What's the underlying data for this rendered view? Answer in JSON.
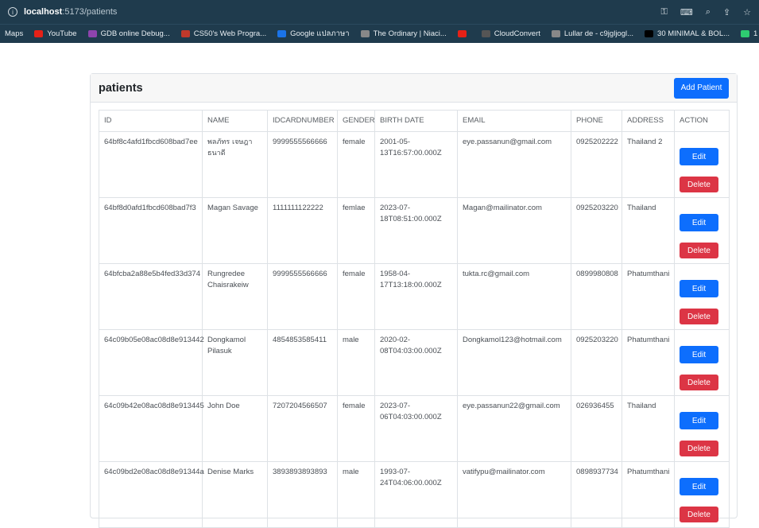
{
  "browser": {
    "url_host": "localhost",
    "url_path": ":5173/patients",
    "bookmarks": [
      {
        "label": "Maps",
        "color": ""
      },
      {
        "label": "YouTube",
        "color": "#e62117"
      },
      {
        "label": "GDB online Debug...",
        "color": "#8e44ad"
      },
      {
        "label": "CS50's Web Progra...",
        "color": "#c0392b"
      },
      {
        "label": "Google แปลภาษา",
        "color": "#1a73e8"
      },
      {
        "label": "The Ordinary | Niaci...",
        "color": "#888888"
      },
      {
        "label": "",
        "color": "#e62117"
      },
      {
        "label": "CloudConvert",
        "color": "#555555"
      },
      {
        "label": "Lullar de - c9jgljogl...",
        "color": "#888888"
      },
      {
        "label": "30 MINIMAL & BOL...",
        "color": "#000000"
      },
      {
        "label": "1",
        "color": "#2ecc71"
      }
    ]
  },
  "page": {
    "title": "patients",
    "add_label": "Add Patient",
    "edit_label": "Edit",
    "delete_label": "Delete"
  },
  "table": {
    "columns": [
      "ID",
      "NAME",
      "IDCARDNUMBER",
      "GENDER",
      "BIRTH DATE",
      "EMAIL",
      "PHONE",
      "ADDRESS",
      "ACTION"
    ],
    "rows": [
      {
        "id": "64bf8c4afd1fbcd608bad7ee",
        "name": "พลภัทร เจษฎา ธนาดี",
        "idcard": "9999555566666",
        "gender": "female",
        "birth": "2001-05-13T16:57:00.000Z",
        "email": "eye.passanun@gmail.com",
        "phone": "0925202222",
        "address": "Thailand 2"
      },
      {
        "id": "64bf8d0afd1fbcd608bad7f3",
        "name": "Magan Savage",
        "idcard": "1111111122222",
        "gender": "femlae",
        "birth": "2023-07-18T08:51:00.000Z",
        "email": "Magan@mailinator.com",
        "phone": "0925203220",
        "address": "Thailand"
      },
      {
        "id": "64bfcba2a88e5b4fed33d374",
        "name": "Rungredee Chaisrakeiw",
        "idcard": "9999555566666",
        "gender": "female",
        "birth": "1958-04-17T13:18:00.000Z",
        "email": "tukta.rc@gmail.com",
        "phone": "0899980808",
        "address": "Phatumthani"
      },
      {
        "id": "64c09b05e08ac08d8e913442",
        "name": "Dongkamol Pilasuk",
        "idcard": "4854853585411",
        "gender": "male",
        "birth": "2020-02-08T04:03:00.000Z",
        "email": "Dongkamol123@hotmail.com",
        "phone": "0925203220",
        "address": "Phatumthani"
      },
      {
        "id": "64c09b42e08ac08d8e913445",
        "name": "John Doe",
        "idcard": "7207204566507",
        "gender": "female",
        "birth": "2023-07-06T04:03:00.000Z",
        "email": "eye.passanun22@gmail.com",
        "phone": "026936455",
        "address": "Thailand"
      },
      {
        "id": "64c09bd2e08ac08d8e91344a",
        "name": "Denise Marks",
        "idcard": "3893893893893",
        "gender": "male",
        "birth": "1993-07-24T04:06:00.000Z",
        "email": "vatifypu@mailinator.com",
        "phone": "0898937734",
        "address": "Phatumthani"
      }
    ]
  }
}
